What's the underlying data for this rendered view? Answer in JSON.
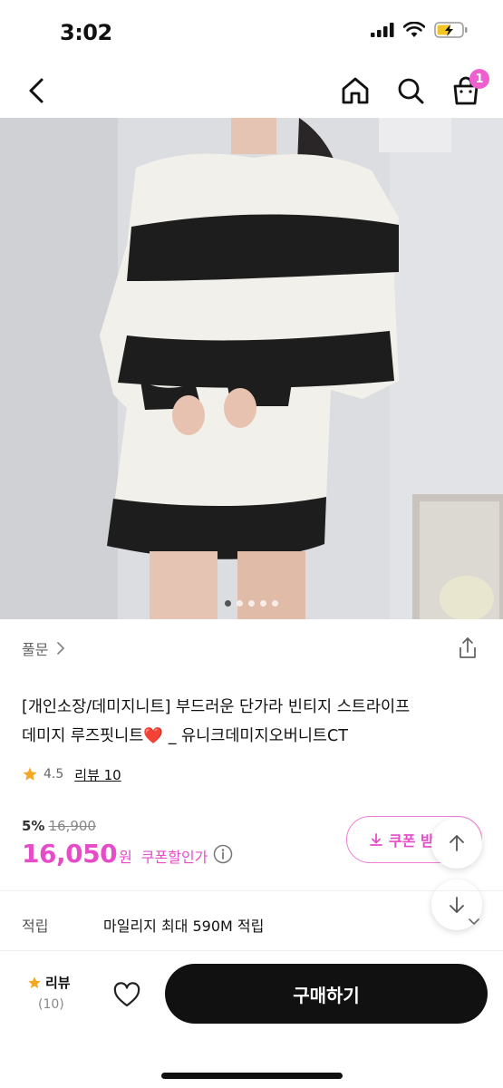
{
  "status": {
    "time": "3:02"
  },
  "nav": {
    "cart_count": "1"
  },
  "gallery": {
    "total": 5,
    "active": 1
  },
  "product": {
    "brand": "풀문",
    "title_line1": "[개인소장/데미지니트] 부드러운 단가라 빈티지 스트라이프",
    "title_line2": "데미지 루즈핏니트❤️ _ 유니크데미지오버니트CT",
    "rating": "4.5",
    "review_link": "리뷰 10"
  },
  "price": {
    "discount_rate": "5%",
    "original": "16,900",
    "sale": "16,050",
    "currency": "원",
    "coupon_price_label": "쿠폰할인가",
    "coupon_button": "쿠폰 받"
  },
  "points": {
    "label": "적립",
    "value": "마일리지 최대 590M 적립"
  },
  "bottom": {
    "review_label": "리뷰",
    "review_count": "(10)",
    "buy_label": "구매하기"
  },
  "colors": {
    "accent": "#e64bc8",
    "badge": "#f05fd0",
    "buy_button": "#111111"
  }
}
